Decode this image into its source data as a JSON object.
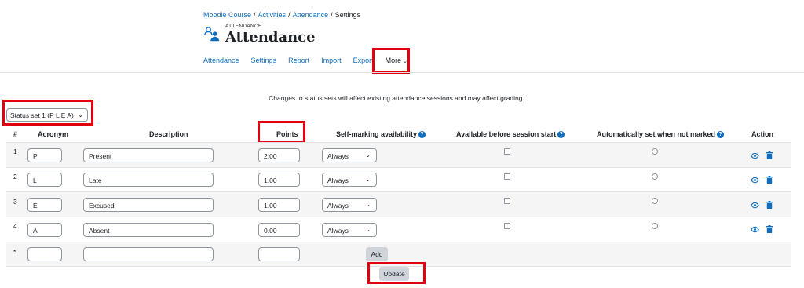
{
  "breadcrumb": [
    "Moodle Course",
    "Activities",
    "Attendance",
    "Settings"
  ],
  "module_label": "ATTENDANCE",
  "page_title": "Attendance",
  "nav": [
    "Attendance",
    "Settings",
    "Report",
    "Import",
    "Export"
  ],
  "nav_more": "More",
  "notice": "Changes to status sets will affect existing attendance sessions and may affect grading.",
  "status_set": "Status set 1 (P L E A)",
  "columns": {
    "num": "#",
    "acronym": "Acronym",
    "description": "Description",
    "points": "Points",
    "selfmark": "Self-marking availability",
    "before": "Available before session start",
    "auto": "Automatically set when not marked",
    "action": "Action"
  },
  "rows": [
    {
      "num": "1",
      "acronym": "P",
      "description": "Present",
      "points": "2.00",
      "availability": "Always"
    },
    {
      "num": "2",
      "acronym": "L",
      "description": "Late",
      "points": "1.00",
      "availability": "Always"
    },
    {
      "num": "3",
      "acronym": "E",
      "description": "Excused",
      "points": "1.00",
      "availability": "Always"
    },
    {
      "num": "4",
      "acronym": "A",
      "description": "Absent",
      "points": "0.00",
      "availability": "Always"
    }
  ],
  "new_row": {
    "num": "*"
  },
  "add_label": "Add",
  "update_label": "Update",
  "colors": {
    "link": "#0f6cbf",
    "highlight": "#e1000f",
    "stripe": "#f5f5f5"
  }
}
